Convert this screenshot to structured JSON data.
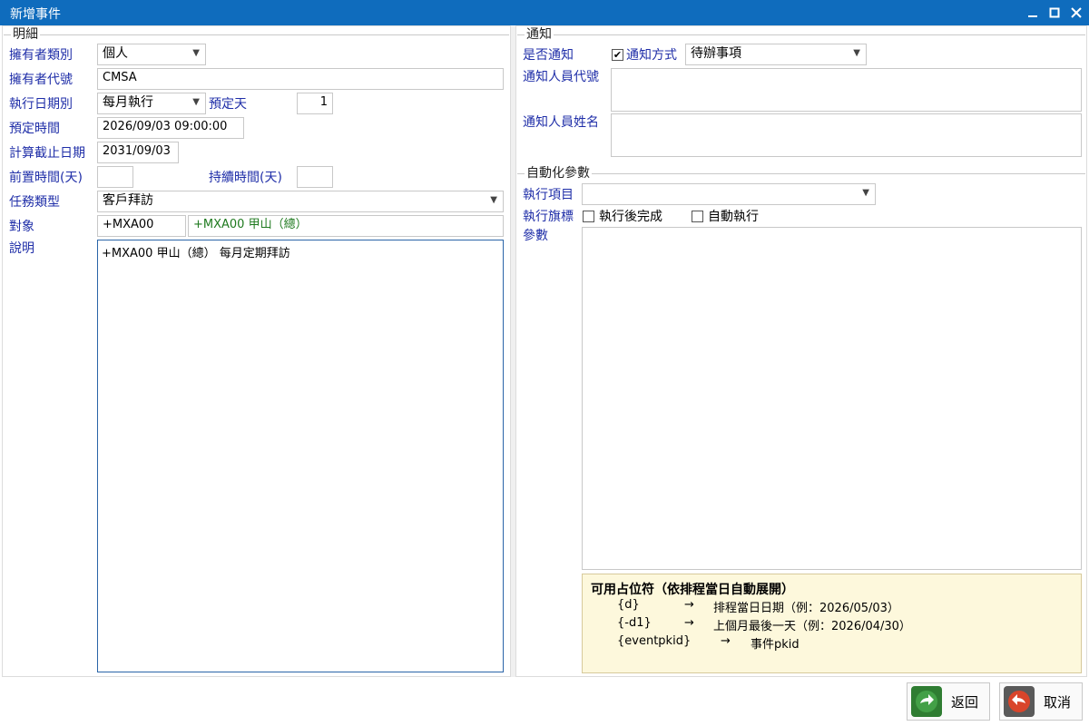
{
  "window": {
    "title": "新增事件"
  },
  "detail": {
    "group_title": "明細",
    "owner_type_label": "擁有者類別",
    "owner_type_value": "個人",
    "owner_code_label": "擁有者代號",
    "owner_code_value": "CMSA",
    "exec_date_type_label": "執行日期別",
    "exec_date_type_value": "每月執行",
    "scheduled_day_label": "預定天",
    "scheduled_day_value": "1",
    "scheduled_time_label": "預定時間",
    "scheduled_time_value": "2026/09/03 09:00:00",
    "calc_end_date_label": "計算截止日期",
    "calc_end_date_value": "2031/09/03",
    "lead_time_label": "前置時間(天)",
    "lead_time_value": "",
    "duration_label": "持續時間(天)",
    "duration_value": "",
    "task_type_label": "任務類型",
    "task_type_value": "客戶拜訪",
    "target_label": "對象",
    "target_code": "+MXA00",
    "target_name": "+MXA00 甲山（總）",
    "description_label": "說明",
    "description_value": "+MXA00 甲山（總） 每月定期拜訪"
  },
  "notification": {
    "group_title": "通知",
    "notify_label": "是否通知",
    "notify_checked": true,
    "notify_method_label": "通知方式",
    "notify_method_value": "待辦事項",
    "notify_person_code_label": "通知人員代號",
    "notify_person_name_label": "通知人員姓名"
  },
  "automation": {
    "group_title": "自動化參數",
    "exec_item_label": "執行項目",
    "exec_item_value": "",
    "exec_flag_label": "執行旗標",
    "flag_complete_label": "執行後完成",
    "flag_auto_label": "自動執行",
    "params_label": "參數",
    "placeholder_title": "可用占位符（依排程當日自動展開）",
    "placeholders": [
      {
        "token": "{d}",
        "arrow": "→",
        "desc": "排程當日日期（例：2026/05/03）"
      },
      {
        "token": "{-d1}",
        "arrow": "→",
        "desc": "上個月最後一天（例：2026/04/30）"
      },
      {
        "token": "{eventpkid}",
        "arrow": "→",
        "desc": "事件pkid"
      }
    ]
  },
  "footer": {
    "return_label": "返回",
    "cancel_label": "取消"
  },
  "colors": {
    "titlebar": "#0f6cbd",
    "label_blue": "#1f2ea8",
    "target_green": "#1f7a1f",
    "hint_bg": "#fdf8dc"
  }
}
